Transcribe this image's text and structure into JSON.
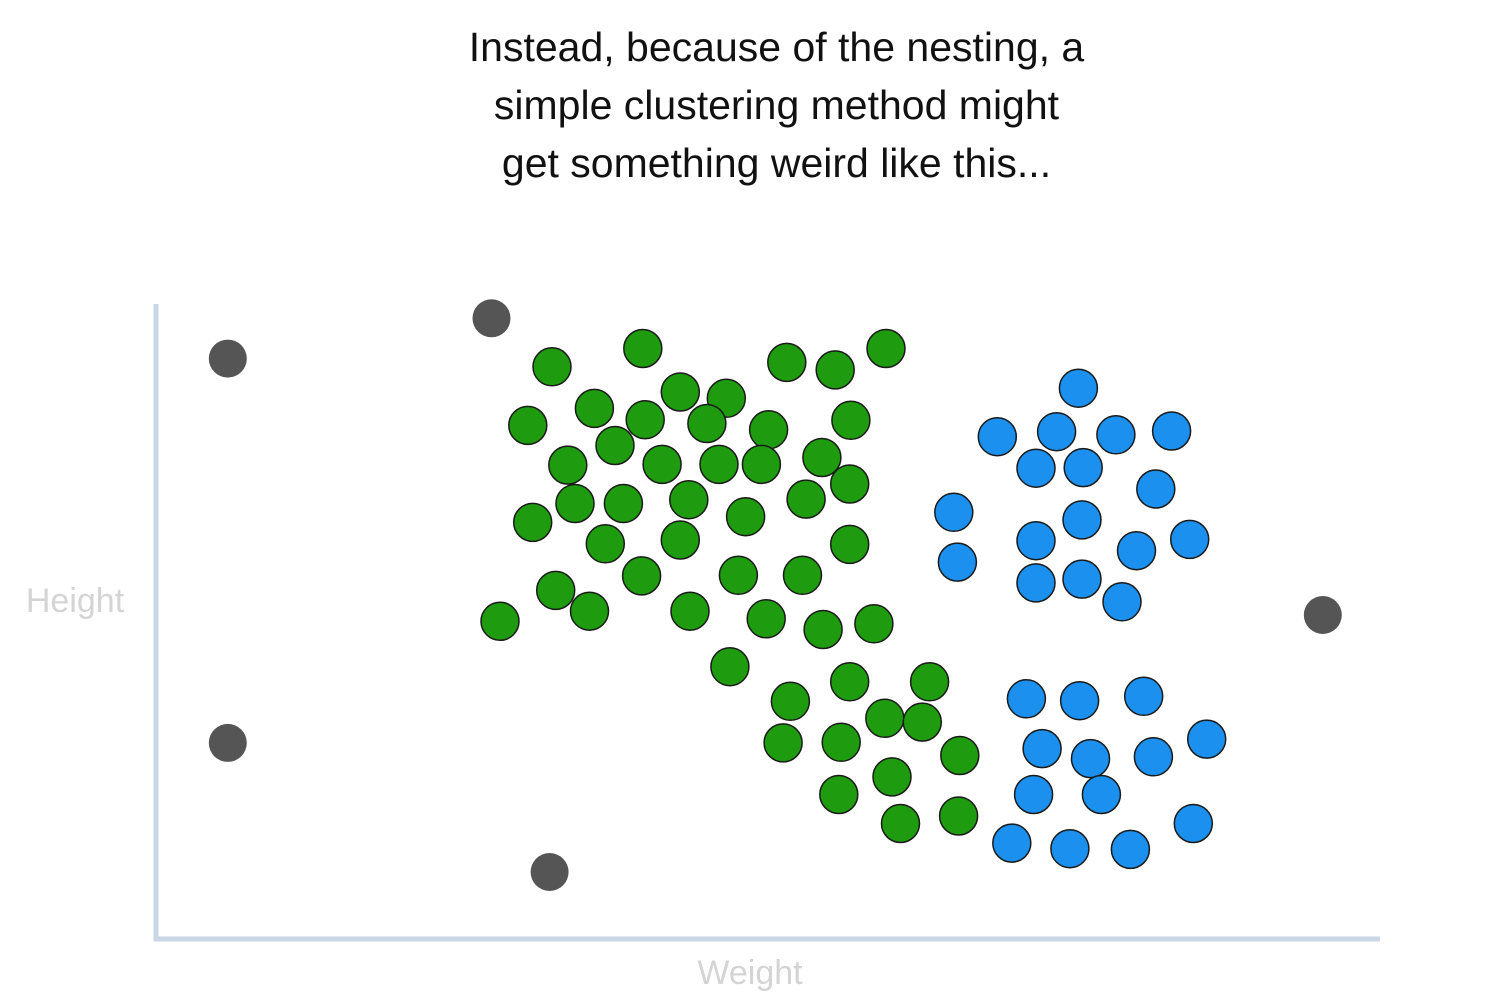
{
  "caption": {
    "line1": "Instead, because of the nesting, a",
    "line2": "simple clustering method might",
    "line3": "get something weird like this..."
  },
  "colors": {
    "axis": "#c8d6e5",
    "green_fill": "#1e9b0e",
    "blue_fill": "#1b90ee",
    "gray_fill": "#555555",
    "outline": "#1a1a1a",
    "axis_label": "#d4d4d4"
  },
  "chart_data": {
    "type": "scatter",
    "xlabel": "Weight",
    "ylabel": "Height",
    "xlim": [
      0,
      100
    ],
    "ylim": [
      0,
      100
    ],
    "grid": false,
    "series": [
      {
        "color": "#555555",
        "points": [
          [
            5.6,
            90.7
          ],
          [
            27.4,
            97.1
          ],
          [
            5.6,
            29.7
          ],
          [
            32.2,
            9.2
          ],
          [
            96.1,
            50.0
          ]
        ]
      },
      {
        "color": "#1e9b0e",
        "points": [
          [
            32.4,
            89.4
          ],
          [
            39.9,
            92.3
          ],
          [
            43.0,
            85.4
          ],
          [
            46.8,
            84.4
          ],
          [
            51.8,
            90.1
          ],
          [
            55.8,
            88.9
          ],
          [
            60.0,
            92.3
          ],
          [
            30.4,
            80.1
          ],
          [
            35.9,
            82.8
          ],
          [
            40.1,
            81.0
          ],
          [
            45.2,
            80.4
          ],
          [
            50.3,
            79.4
          ],
          [
            57.1,
            80.9
          ],
          [
            33.7,
            73.8
          ],
          [
            37.6,
            76.9
          ],
          [
            41.5,
            73.9
          ],
          [
            46.2,
            73.9
          ],
          [
            49.7,
            73.9
          ],
          [
            54.7,
            75.0
          ],
          [
            57.0,
            70.8
          ],
          [
            30.8,
            64.7
          ],
          [
            34.3,
            67.7
          ],
          [
            38.3,
            67.7
          ],
          [
            43.7,
            68.3
          ],
          [
            48.4,
            65.6
          ],
          [
            53.4,
            68.4
          ],
          [
            36.8,
            61.3
          ],
          [
            43.0,
            61.9
          ],
          [
            57.0,
            61.2
          ],
          [
            32.7,
            53.9
          ],
          [
            39.8,
            56.2
          ],
          [
            47.8,
            56.3
          ],
          [
            53.1,
            56.3
          ],
          [
            28.1,
            49.0
          ],
          [
            35.5,
            50.6
          ],
          [
            43.8,
            50.6
          ],
          [
            50.1,
            49.4
          ],
          [
            54.8,
            47.7
          ],
          [
            59.0,
            48.6
          ],
          [
            47.1,
            41.8
          ],
          [
            52.1,
            36.3
          ],
          [
            57.0,
            39.4
          ],
          [
            63.6,
            39.4
          ],
          [
            59.9,
            33.6
          ],
          [
            63.0,
            33.0
          ],
          [
            51.5,
            29.7
          ],
          [
            56.3,
            29.8
          ],
          [
            66.1,
            27.7
          ],
          [
            56.1,
            21.5
          ],
          [
            60.5,
            24.3
          ],
          [
            61.2,
            16.9
          ],
          [
            66.0,
            18.1
          ]
        ]
      },
      {
        "color": "#1b90ee",
        "points": [
          [
            75.9,
            86.0
          ],
          [
            69.2,
            78.3
          ],
          [
            74.1,
            79.1
          ],
          [
            79.0,
            78.6
          ],
          [
            83.6,
            79.2
          ],
          [
            72.4,
            73.3
          ],
          [
            76.3,
            73.4
          ],
          [
            82.3,
            70.0
          ],
          [
            65.6,
            66.3
          ],
          [
            76.2,
            65.1
          ],
          [
            72.4,
            61.8
          ],
          [
            80.7,
            60.2
          ],
          [
            85.1,
            62.0
          ],
          [
            65.9,
            58.4
          ],
          [
            72.4,
            55.1
          ],
          [
            76.2,
            55.7
          ],
          [
            79.5,
            52.1
          ],
          [
            71.6,
            36.7
          ],
          [
            76.0,
            36.4
          ],
          [
            81.3,
            37.1
          ],
          [
            72.9,
            28.8
          ],
          [
            76.9,
            27.2
          ],
          [
            82.1,
            27.5
          ],
          [
            86.5,
            30.3
          ],
          [
            72.2,
            21.5
          ],
          [
            77.8,
            21.5
          ],
          [
            85.4,
            16.9
          ],
          [
            70.4,
            13.8
          ],
          [
            75.2,
            12.9
          ],
          [
            80.2,
            12.8
          ]
        ]
      }
    ]
  }
}
